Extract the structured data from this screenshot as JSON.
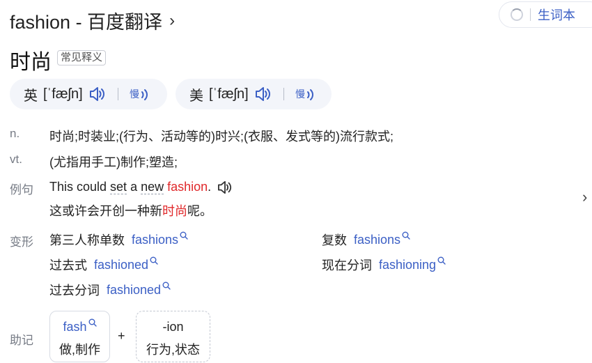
{
  "header": {
    "title": "fashion - 百度翻译",
    "chevron": "›",
    "vocab_button": "生词本"
  },
  "entry": {
    "headword": "时尚",
    "badge": "常见释义"
  },
  "pronunciations": [
    {
      "region": "英",
      "ipa": "[ˈfæʃn]"
    },
    {
      "region": "美",
      "ipa": "[ˈfæʃn]"
    }
  ],
  "definitions": [
    {
      "pos": "n.",
      "text": "时尚;时装业;(行为、活动等的)时兴;(衣服、发式等的)流行款式;"
    },
    {
      "pos": "vt.",
      "text": "(尤指用手工)制作;塑造;"
    }
  ],
  "example": {
    "label": "例句",
    "en_pre1": "This could ",
    "en_dash1": "set",
    "en_mid": " a ",
    "en_dash2": "new",
    "en_space": " ",
    "en_highlight": "fashion",
    "en_post": ".",
    "zh_pre": "这或许会开创一种新",
    "zh_highlight": "时尚",
    "zh_post": "呢。"
  },
  "forms": {
    "label": "变形",
    "items": [
      {
        "name": "第三人称单数",
        "word": "fashions"
      },
      {
        "name": "复数",
        "word": "fashions"
      },
      {
        "name": "过去式",
        "word": "fashioned"
      },
      {
        "name": "现在分词",
        "word": "fashioning"
      },
      {
        "name": "过去分词",
        "word": "fashioned"
      }
    ]
  },
  "mnemonic": {
    "label": "助记",
    "parts": [
      {
        "top": "fash",
        "bottom": "做,制作"
      },
      {
        "top": "-ion",
        "bottom": "行为,状态"
      }
    ],
    "plus": "+"
  },
  "colors": {
    "accent": "#3b5fc5",
    "highlight": "#e0282a",
    "pill_bg": "#f3f5fa"
  }
}
